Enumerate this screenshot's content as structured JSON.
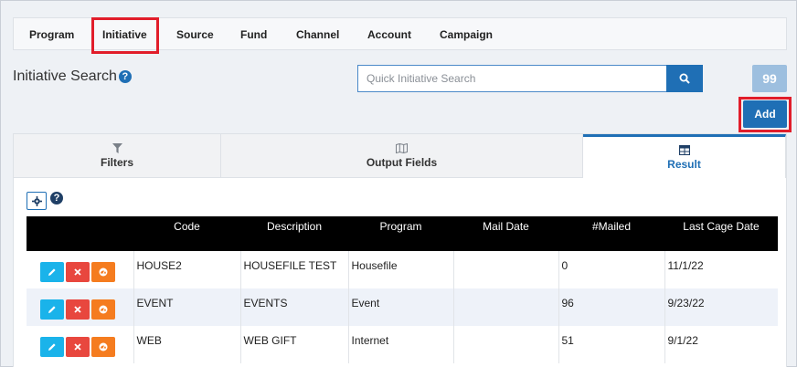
{
  "nav": {
    "tabs": [
      {
        "label": "Program"
      },
      {
        "label": "Initiative"
      },
      {
        "label": "Source"
      },
      {
        "label": "Fund"
      },
      {
        "label": "Channel"
      },
      {
        "label": "Account"
      },
      {
        "label": "Campaign"
      }
    ],
    "active": "Initiative"
  },
  "page": {
    "title": "Initiative Search"
  },
  "search": {
    "placeholder": "Quick Initiative Search",
    "value": ""
  },
  "buttons": {
    "add_label": "Add",
    "quote_label": "99"
  },
  "panel": {
    "tabs": [
      {
        "label": "Filters",
        "icon": "filter-icon"
      },
      {
        "label": "Output Fields",
        "icon": "map-icon"
      },
      {
        "label": "Result",
        "icon": "table-icon"
      }
    ],
    "active": "Result"
  },
  "table": {
    "columns": [
      "",
      "Code",
      "Description",
      "Program",
      "Mail Date",
      "#Mailed",
      "Last Cage Date"
    ],
    "rows": [
      {
        "code": "HOUSE2",
        "description": "HOUSEFILE TEST",
        "program": "Housefile",
        "mail_date": "",
        "mailed": "0",
        "last_cage_date": "11/1/22"
      },
      {
        "code": "EVENT",
        "description": "EVENTS",
        "program": "Event",
        "mail_date": "",
        "mailed": "96",
        "last_cage_date": "9/23/22"
      },
      {
        "code": "WEB",
        "description": "WEB GIFT",
        "program": "Internet",
        "mail_date": "",
        "mailed": "51",
        "last_cage_date": "9/1/22"
      }
    ]
  },
  "colors": {
    "accent": "#1f6fb5",
    "highlight": "#e11d2a",
    "edit": "#1ab3ea",
    "delete": "#e8473e",
    "info": "#f57c1f"
  }
}
